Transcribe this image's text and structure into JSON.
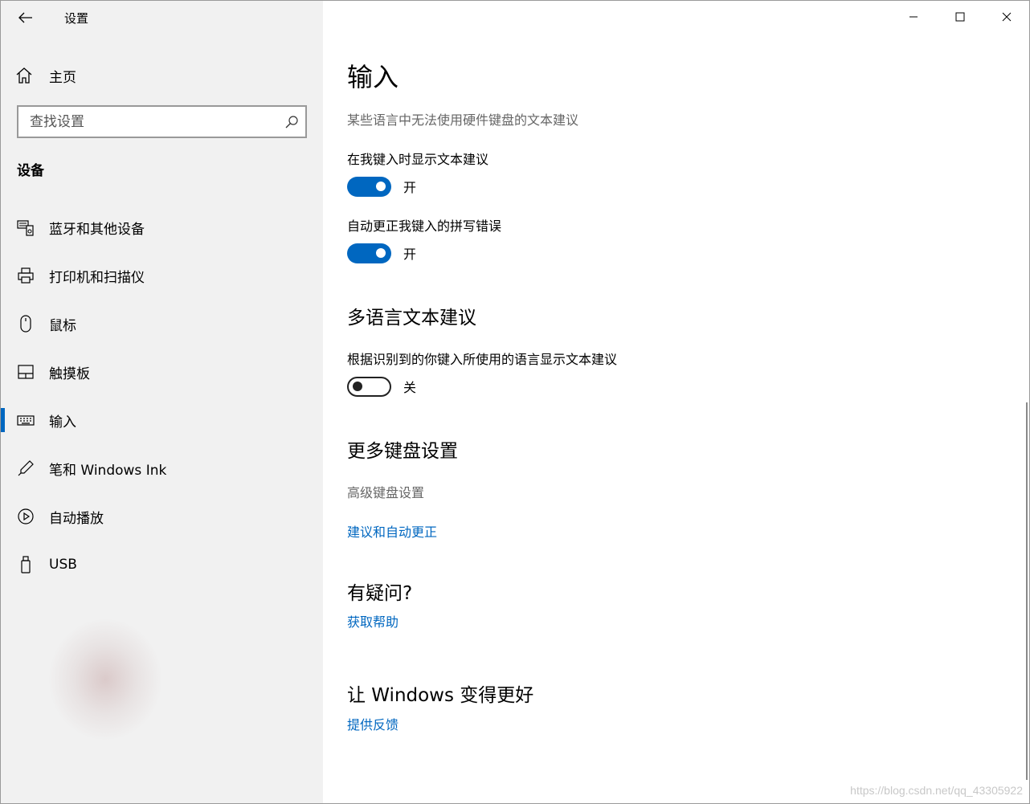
{
  "window": {
    "title": "设置",
    "controls": {
      "minimize": "minimize",
      "maximize": "maximize",
      "close": "close"
    }
  },
  "sidebar": {
    "home_label": "主页",
    "search_placeholder": "查找设置",
    "section_title": "设备",
    "items": [
      {
        "label": "蓝牙和其他设备",
        "icon": "bluetooth-devices-icon",
        "active": false
      },
      {
        "label": "打印机和扫描仪",
        "icon": "printer-icon",
        "active": false
      },
      {
        "label": "鼠标",
        "icon": "mouse-icon",
        "active": false
      },
      {
        "label": "触摸板",
        "icon": "touchpad-icon",
        "active": false
      },
      {
        "label": "输入",
        "icon": "keyboard-icon",
        "active": true
      },
      {
        "label": "笔和 Windows Ink",
        "icon": "pen-icon",
        "active": false
      },
      {
        "label": "自动播放",
        "icon": "autoplay-icon",
        "active": false
      },
      {
        "label": "USB",
        "icon": "usb-icon",
        "active": false
      }
    ]
  },
  "main": {
    "title": "输入",
    "hw_note": "某些语言中无法使用硬件键盘的文本建议",
    "setting1": {
      "label": "在我键入时显示文本建议",
      "state": "开",
      "on": true
    },
    "setting2": {
      "label": "自动更正我键入的拼写错误",
      "state": "开",
      "on": true
    },
    "multilang": {
      "heading": "多语言文本建议",
      "label": "根据识别到的你键入所使用的语言显示文本建议",
      "state": "关",
      "on": false
    },
    "more_keyboard": {
      "heading": "更多键盘设置",
      "advanced": "高级键盘设置",
      "link": "建议和自动更正"
    },
    "questions": {
      "heading": "有疑问?",
      "link": "获取帮助"
    },
    "improve": {
      "heading": "让 Windows 变得更好",
      "link": "提供反馈"
    }
  },
  "colors": {
    "accent": "#0067c0",
    "sidebar_bg": "#f1f1f1"
  },
  "watermark": "https://blog.csdn.net/qq_43305922"
}
